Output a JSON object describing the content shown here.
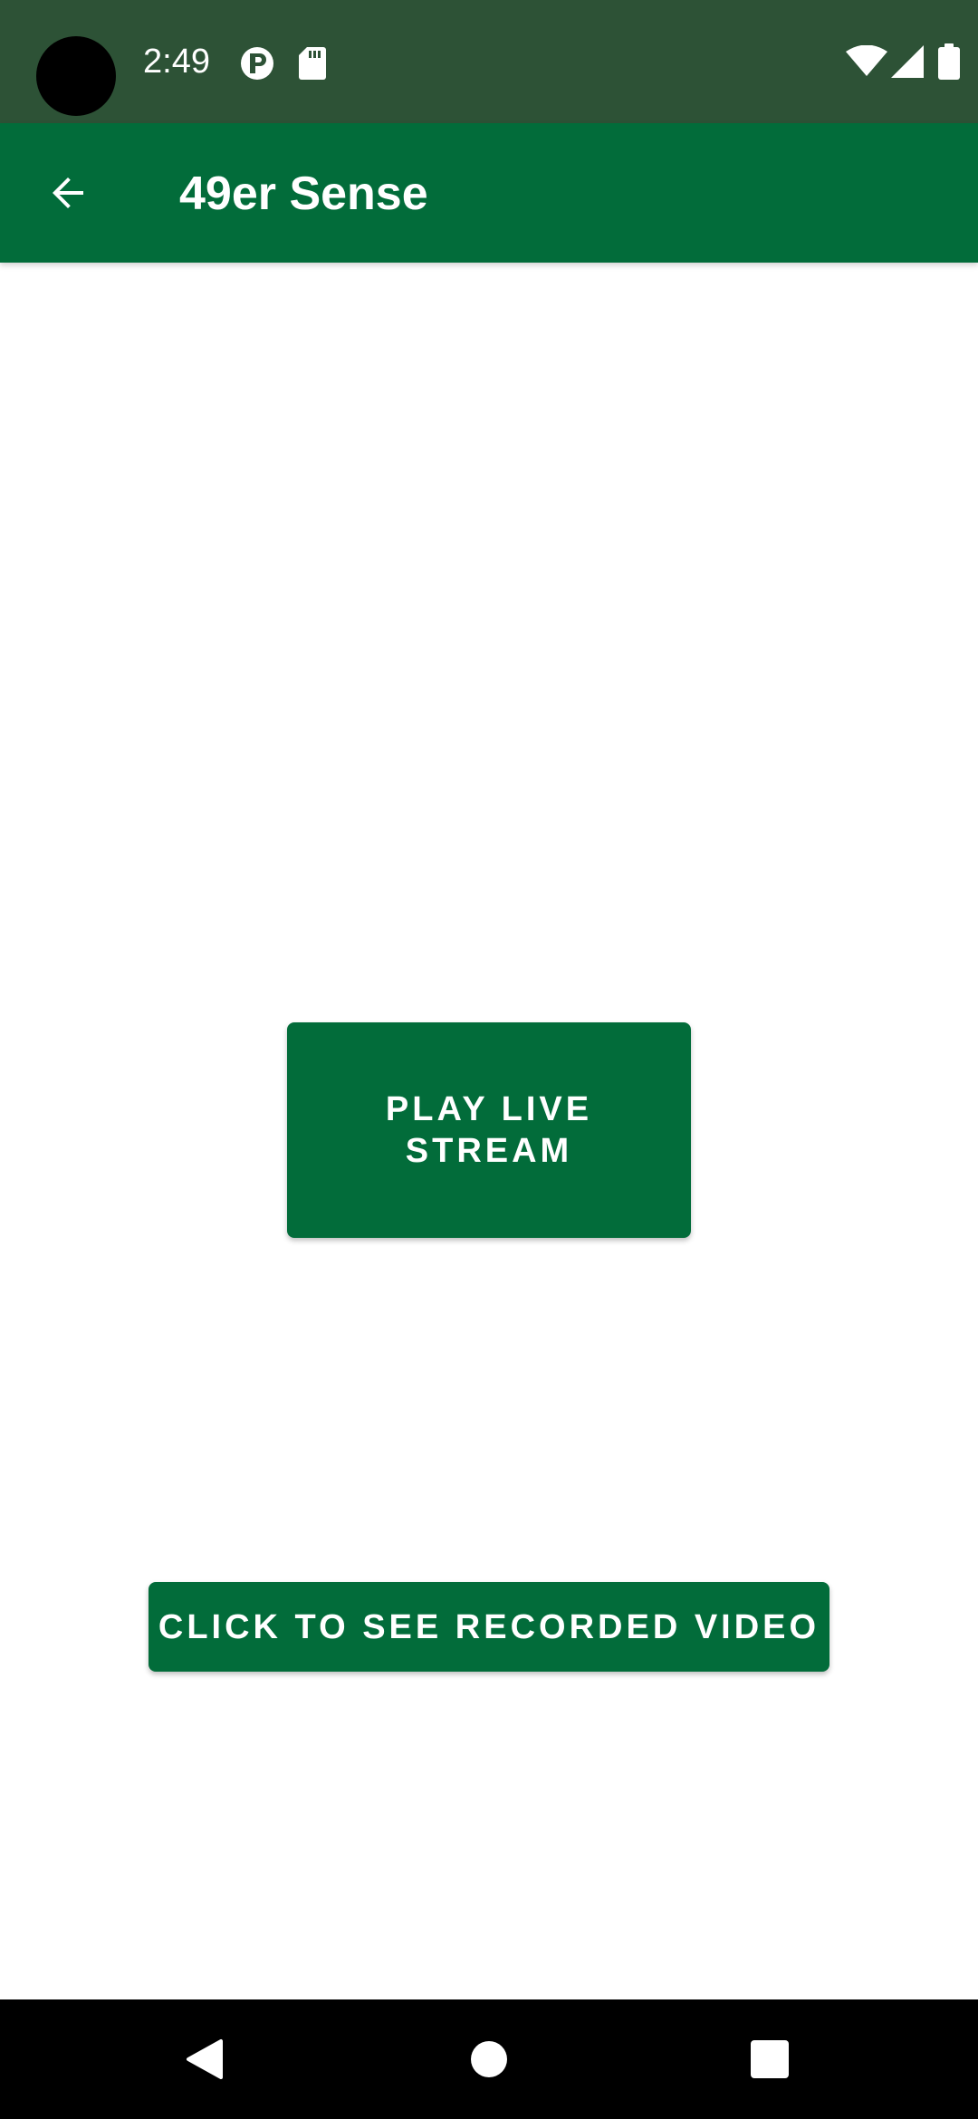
{
  "status_bar": {
    "time": "2:49",
    "icons": [
      "camera-cutout",
      "p-notification-icon",
      "sd-card-icon",
      "wifi-icon",
      "signal-icon",
      "battery-icon"
    ]
  },
  "app_bar": {
    "title": "49er Sense",
    "back_icon": "arrow-back-icon"
  },
  "main": {
    "live_button_label": "PLAY LIVE STREAM",
    "recorded_button_label": "CLICK TO SEE RECORDED VIDEO"
  },
  "nav_bar": {
    "icons": [
      "back-triangle-icon",
      "home-circle-icon",
      "recents-square-icon"
    ]
  },
  "colors": {
    "status_bar": "#2d5236",
    "primary": "#026c3a",
    "background": "#ffffff",
    "nav_bar": "#000000"
  }
}
